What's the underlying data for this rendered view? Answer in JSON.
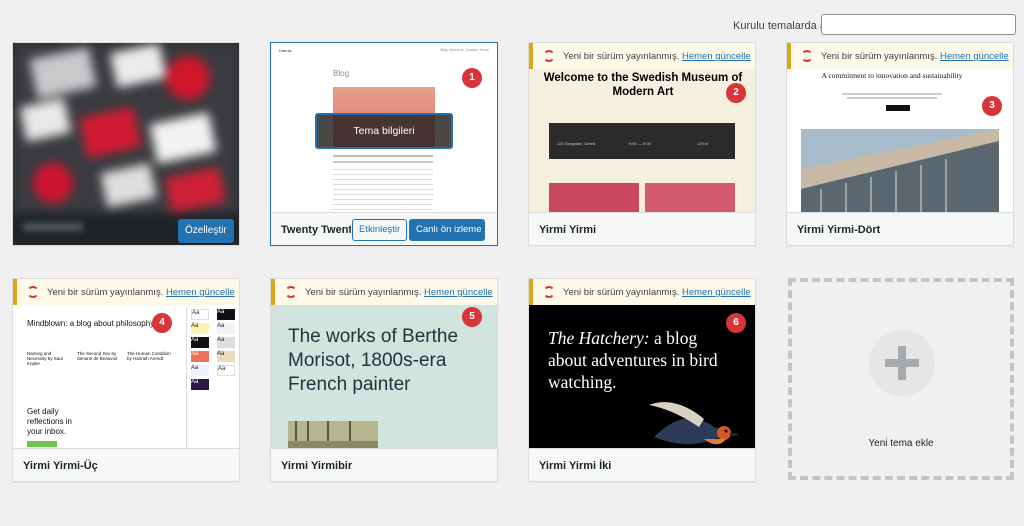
{
  "search": {
    "label": "Kurulu temalarda ara",
    "placeholder": ""
  },
  "update_notice": {
    "text": "Yeni bir sürüm yayınlanmış.",
    "link": "Hemen güncelle"
  },
  "active_theme": {
    "button": "Özelleştir"
  },
  "themes": [
    {
      "name": "Twenty Twenty",
      "badge": "1",
      "overlay": "Tema bilgileri",
      "activate": "Etkinleştir",
      "preview": "Canlı ön izleme",
      "shot": {
        "site": "Dannis",
        "heading": "Blog",
        "nav": [
          "Blog",
          "About Us",
          "Contact",
          "Home"
        ]
      }
    },
    {
      "name": "Yirmi Yirmi",
      "badge": "2",
      "shot": {
        "title": "Welcome to the Swedish Museum of Modern Art",
        "info": [
          "123 Storgatan, Umeå",
          "9:00 — 5:00",
          "129 kr"
        ]
      }
    },
    {
      "name": "Yirmi Yirmi-Dört",
      "badge": "3",
      "shot": {
        "title": "A commitment to innovation and sustainability"
      }
    },
    {
      "name": "Yirmi Yirmi-Üç",
      "badge": "4",
      "shot": {
        "title": "Mindblown: a blog about philosophy.",
        "books": [
          "Naming and Necessity by Saul Kripke",
          "The Second Sex by Simone de Beauvoir",
          "The Human Condition by Hannah Arendt"
        ],
        "cta": "Get daily reflections in your inbox.",
        "swatch": "Aa"
      }
    },
    {
      "name": "Yirmi Yirmibir",
      "badge": "5",
      "shot": {
        "title": "The works of Berthe Morisot, 1800s-era French painter"
      }
    },
    {
      "name": "Yirmi Yirmi İki",
      "badge": "6",
      "shot": {
        "title_italic": "The Hatchery:",
        "title_rest": "a blog about adventures in bird watching."
      }
    }
  ],
  "add_new": {
    "label": "Yeni tema ekle"
  },
  "colors": {
    "accent": "#2271b1",
    "badge": "#d63638",
    "notice_border": "#dba617"
  }
}
